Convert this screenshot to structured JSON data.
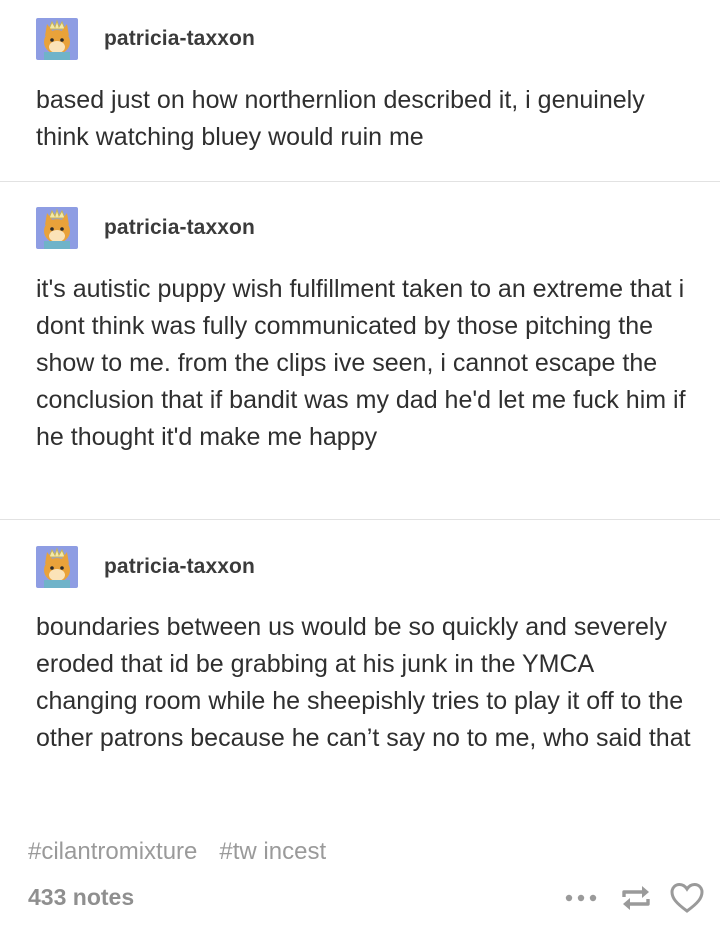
{
  "posts": [
    {
      "username": "patricia-taxxon",
      "text": "based just on how northernlion described it, i genuinely think watching bluey would ruin me"
    },
    {
      "username": "patricia-taxxon",
      "text": "it's autistic puppy wish fulfillment taken to an extreme that i dont think was fully communicated by those pitching the show to me. from the clips ive seen, i cannot escape the conclusion that if bandit was my dad he'd let me fuck him if he thought it'd make me happy"
    },
    {
      "username": "patricia-taxxon",
      "text": "boundaries between us would be so quickly and severely eroded that id be grabbing at his junk in the YMCA changing room while he sheepishly tries to play it off to the other patrons because he can’t say no to me, who said that"
    }
  ],
  "tags": [
    "#cilantromixture",
    "#tw incest"
  ],
  "notes": "433 notes",
  "icons": {
    "avatar": "avatar-cat-crown",
    "more": "more-dots-icon",
    "reblog": "reblog-icon",
    "like": "heart-icon"
  },
  "colors": {
    "text": "#2f2f2f",
    "muted": "#9a9a9a",
    "divider": "#e2e2e2",
    "avatar_bg": "#8e9de3"
  }
}
